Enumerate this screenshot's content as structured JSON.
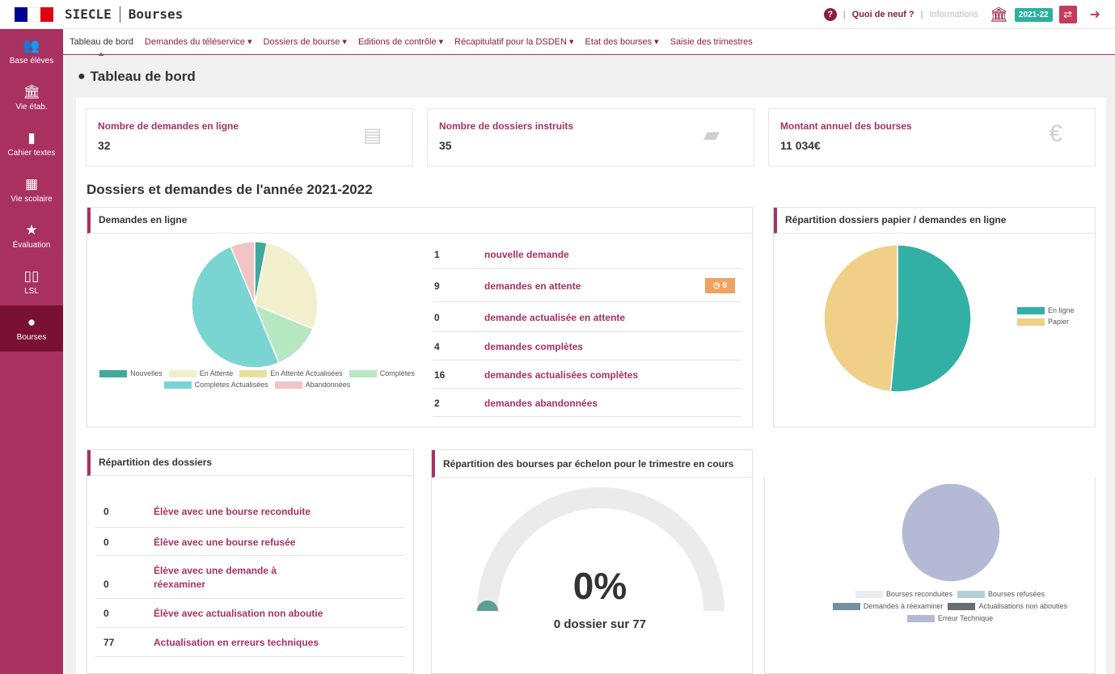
{
  "header": {
    "app_name": "SIECLE",
    "module_name": "Bourses",
    "help_icon": "question-circle-icon",
    "links": [
      "Quoi de neuf ?",
      "Informations"
    ],
    "separator": "|",
    "year": "2021-22",
    "flag_colors": [
      "#000091",
      "#ffffff",
      "#e1000f"
    ]
  },
  "sidebar": {
    "items": [
      {
        "label": "Base élèves",
        "icon": "users-icon"
      },
      {
        "label": "Vie étab.",
        "icon": "institution-icon"
      },
      {
        "label": "Cahier textes",
        "icon": "book-icon"
      },
      {
        "label": "Vie scolaire",
        "icon": "calendar-icon"
      },
      {
        "label": "Évaluation",
        "icon": "star-icon"
      },
      {
        "label": "LSL",
        "icon": "open-book-icon"
      },
      {
        "label": "Bourses",
        "icon": "money-bag-icon"
      }
    ]
  },
  "nav": {
    "items": [
      "Tableau de bord",
      "Demandes du téléservice ▾",
      "Dossiers de bourse ▾",
      "Editions de contrôle ▾",
      "Récapitulatif pour la DSDEN ▾",
      "Etat des bourses ▾",
      "Saisie des trimestres"
    ]
  },
  "page": {
    "title": "Tableau de bord",
    "icon": "money-bag-icon"
  },
  "stats": [
    {
      "label": "Nombre de demandes en ligne",
      "value": "32",
      "icon": "file-download-icon"
    },
    {
      "label": "Nombre de dossiers instruits",
      "value": "35",
      "icon": "folder-open-icon"
    },
    {
      "label": "Montant annuel des bourses",
      "value": "11 034€",
      "icon": "euro-icon"
    }
  ],
  "section_title": "Dossiers et demandes de l'année 2021-2022",
  "demandes_panel": {
    "title": "Demandes en ligne",
    "list": [
      {
        "count": "1",
        "label": "nouvelle demande"
      },
      {
        "count": "9",
        "label": "demandes en attente",
        "badge": "8"
      },
      {
        "count": "0",
        "label": "demande actualisée en attente"
      },
      {
        "count": "4",
        "label": "demandes complètes"
      },
      {
        "count": "16",
        "label": "demandes actualisées complètes"
      },
      {
        "count": "2",
        "label": "demandes abandonnées"
      }
    ],
    "badge_icon": "clock-icon"
  },
  "repartition_papier_panel": {
    "title": "Répartition dossiers papier / demandes en ligne"
  },
  "repartition_dossiers_panel": {
    "title": "Répartition des dossiers",
    "list": [
      {
        "count": "0",
        "label": "Élève avec une bourse reconduite"
      },
      {
        "count": "0",
        "label": "Élève avec une bourse refusée"
      },
      {
        "count": "0",
        "label": "Élève avec une demande à réexaminer"
      },
      {
        "count": "0",
        "label": "Élève avec actualisation non aboutie"
      },
      {
        "count": "77",
        "label": "Actualisation en erreurs techniques"
      }
    ]
  },
  "echelon_panel": {
    "title": "Répartition des bourses par échelon pour le trimestre en cours",
    "gauge_value": "0%",
    "gauge_sub": "0 dossier sur 77"
  },
  "chart_data": [
    {
      "type": "pie",
      "categories": [
        "Nouvelles",
        "En Attente",
        "En Attente Actualisées",
        "Complètes",
        "Complètes Actualisées",
        "Abandonnées"
      ],
      "values": [
        1,
        9,
        0,
        4,
        16,
        2
      ],
      "colors": [
        "#40a99a",
        "#f2efcd",
        "#e7e0a0",
        "#b6e8c2",
        "#7ad4d2",
        "#f2c4c4"
      ]
    },
    {
      "type": "pie",
      "categories": [
        "En ligne",
        "Papier"
      ],
      "values": [
        51.5,
        48.5
      ],
      "colors": [
        "#33b0a6",
        "#f0cf88"
      ]
    },
    {
      "type": "gauge",
      "value": 0,
      "max": 77,
      "colors": [
        "#ebebeb",
        "#5e9e94"
      ]
    },
    {
      "type": "pie",
      "categories": [
        "Bourses reconduites",
        "Bourses refusées",
        "Demandes à réexaminer",
        "Actualisations non abouties",
        "Erreur Technique"
      ],
      "values": [
        0,
        0,
        0,
        0,
        77
      ],
      "colors": [
        "#e9edf0",
        "#b3d0d6",
        "#7291a0",
        "#676c70",
        "#b4b9d6"
      ]
    }
  ]
}
